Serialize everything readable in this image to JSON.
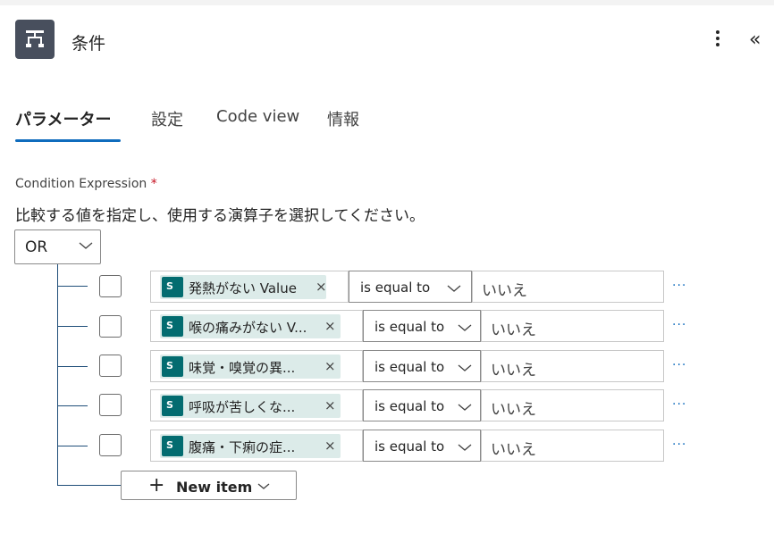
{
  "header": {
    "title": "条件",
    "icon": "condition-icon",
    "more_icon": "more-vertical-icon",
    "collapse_icon": "double-chevron-left-icon",
    "collapse_glyph": "«"
  },
  "tabs": [
    {
      "label": "パラメーター",
      "active": true
    },
    {
      "label": "設定",
      "active": false
    },
    {
      "label": "Code view",
      "active": false
    },
    {
      "label": "情報",
      "active": false
    }
  ],
  "condition": {
    "label": "Condition Expression",
    "required_mark": "*",
    "description": "比較する値を指定し、使用する演算子を選択してください。",
    "group_operator": "OR"
  },
  "rows": [
    {
      "token": "発熱がない Value",
      "operator": "is equal to",
      "value": "いいえ"
    },
    {
      "token": "喉の痛みがない V...",
      "operator": "is equal to",
      "value": "いいえ"
    },
    {
      "token": "味覚・嗅覚の異...",
      "operator": "is equal to",
      "value": "いいえ"
    },
    {
      "token": "呼吸が苦しくな...",
      "operator": "is equal to",
      "value": "いいえ"
    },
    {
      "token": "腹痛・下痢の症...",
      "operator": "is equal to",
      "value": "いいえ"
    }
  ],
  "token_remove_glyph": "×",
  "token_icon_text": "S",
  "row_more_glyph": "···",
  "new_item": {
    "plus": "+",
    "label": "New item"
  },
  "colors": {
    "accent": "#0f6cbd",
    "token_bg": "#dcebe9",
    "sharepoint": "#036c70"
  }
}
